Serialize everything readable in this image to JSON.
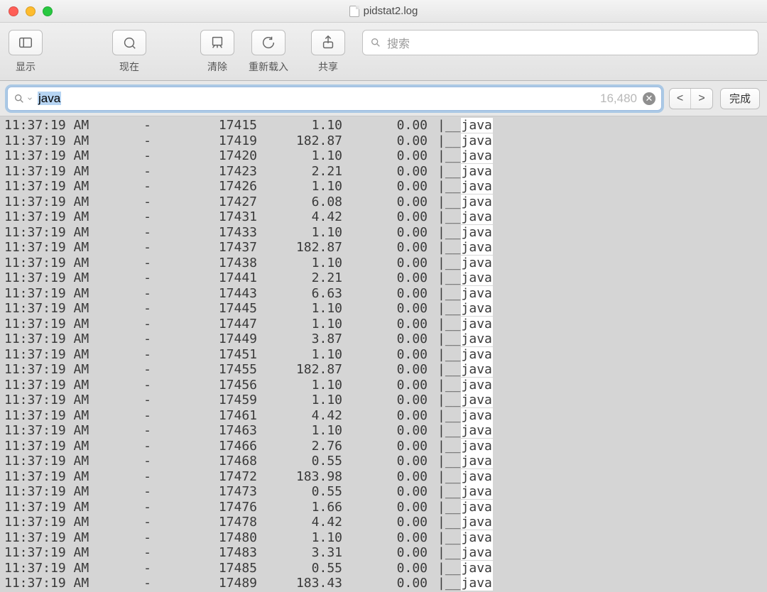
{
  "window": {
    "title": "pidstat2.log"
  },
  "toolbar": {
    "show_label": "显示",
    "now_label": "现在",
    "clear_label": "清除",
    "reload_label": "重新载入",
    "share_label": "共享",
    "search_placeholder": "搜索"
  },
  "findbar": {
    "query": "java",
    "match_count": "16,480",
    "prev_label": "<",
    "next_label": ">",
    "done_label": "完成"
  },
  "log": {
    "time": "11:37:19 AM",
    "user": "-",
    "cmd_prefix": "|__",
    "cmd_name": "java",
    "rows": [
      {
        "pid": "17415",
        "v1": "1.10",
        "v2": "0.00"
      },
      {
        "pid": "17419",
        "v1": "182.87",
        "v2": "0.00"
      },
      {
        "pid": "17420",
        "v1": "1.10",
        "v2": "0.00"
      },
      {
        "pid": "17423",
        "v1": "2.21",
        "v2": "0.00"
      },
      {
        "pid": "17426",
        "v1": "1.10",
        "v2": "0.00"
      },
      {
        "pid": "17427",
        "v1": "6.08",
        "v2": "0.00"
      },
      {
        "pid": "17431",
        "v1": "4.42",
        "v2": "0.00"
      },
      {
        "pid": "17433",
        "v1": "1.10",
        "v2": "0.00"
      },
      {
        "pid": "17437",
        "v1": "182.87",
        "v2": "0.00"
      },
      {
        "pid": "17438",
        "v1": "1.10",
        "v2": "0.00"
      },
      {
        "pid": "17441",
        "v1": "2.21",
        "v2": "0.00"
      },
      {
        "pid": "17443",
        "v1": "6.63",
        "v2": "0.00"
      },
      {
        "pid": "17445",
        "v1": "1.10",
        "v2": "0.00"
      },
      {
        "pid": "17447",
        "v1": "1.10",
        "v2": "0.00"
      },
      {
        "pid": "17449",
        "v1": "3.87",
        "v2": "0.00"
      },
      {
        "pid": "17451",
        "v1": "1.10",
        "v2": "0.00"
      },
      {
        "pid": "17455",
        "v1": "182.87",
        "v2": "0.00"
      },
      {
        "pid": "17456",
        "v1": "1.10",
        "v2": "0.00"
      },
      {
        "pid": "17459",
        "v1": "1.10",
        "v2": "0.00"
      },
      {
        "pid": "17461",
        "v1": "4.42",
        "v2": "0.00"
      },
      {
        "pid": "17463",
        "v1": "1.10",
        "v2": "0.00"
      },
      {
        "pid": "17466",
        "v1": "2.76",
        "v2": "0.00"
      },
      {
        "pid": "17468",
        "v1": "0.55",
        "v2": "0.00"
      },
      {
        "pid": "17472",
        "v1": "183.98",
        "v2": "0.00"
      },
      {
        "pid": "17473",
        "v1": "0.55",
        "v2": "0.00"
      },
      {
        "pid": "17476",
        "v1": "1.66",
        "v2": "0.00"
      },
      {
        "pid": "17478",
        "v1": "4.42",
        "v2": "0.00"
      },
      {
        "pid": "17480",
        "v1": "1.10",
        "v2": "0.00"
      },
      {
        "pid": "17483",
        "v1": "3.31",
        "v2": "0.00"
      },
      {
        "pid": "17485",
        "v1": "0.55",
        "v2": "0.00"
      },
      {
        "pid": "17489",
        "v1": "183.43",
        "v2": "0.00"
      }
    ]
  }
}
